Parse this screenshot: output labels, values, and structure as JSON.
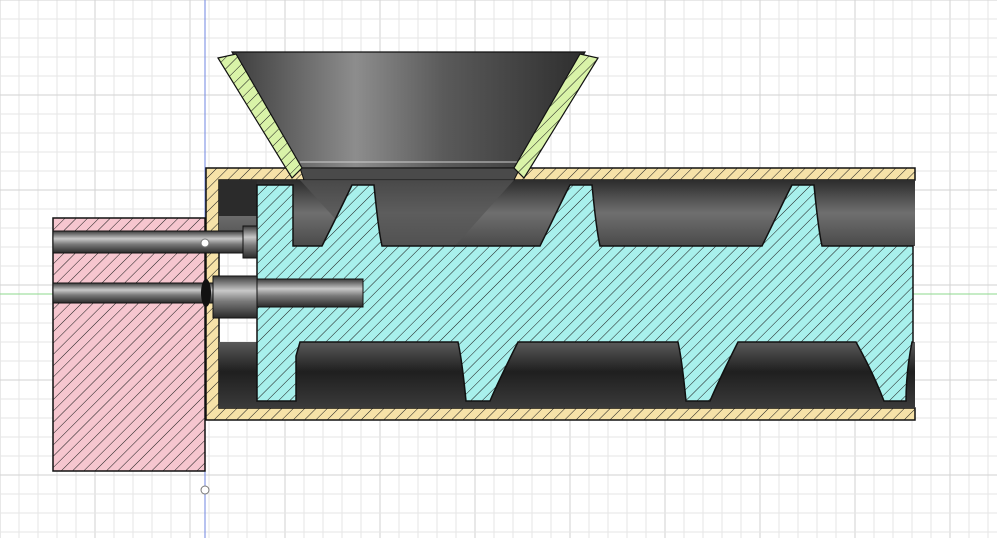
{
  "app": {
    "view": "section-analysis"
  },
  "colors": {
    "background": "#ffffff",
    "grid_minor": "#e6e6e6",
    "grid_major": "#d2d2d2",
    "axis_vertical": "#6f86e0",
    "axis_horizontal": "#8ed88e",
    "section_screw": "#a8f0ec",
    "section_barrel": "#f6e2a8",
    "section_hopper": "#d9f3a8",
    "section_motor": "#f6c6cf",
    "outline": "#111111"
  },
  "parts": [
    {
      "name": "hopper",
      "fill_name": "section_hopper"
    },
    {
      "name": "barrel-tube",
      "fill_name": "section_barrel"
    },
    {
      "name": "auger-screw",
      "fill_name": "section_screw"
    },
    {
      "name": "drive-shaft",
      "fill_name": "steel"
    },
    {
      "name": "motor-block",
      "fill_name": "section_motor"
    }
  ],
  "pivot": {
    "icon": "pivot-point-icon"
  }
}
